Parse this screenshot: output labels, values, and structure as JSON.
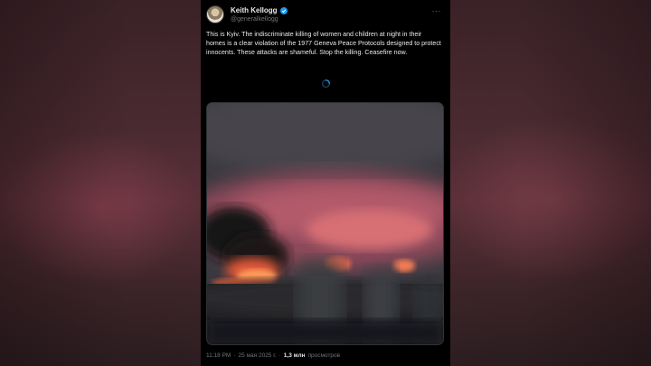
{
  "author": {
    "name": "Keith Kellogg",
    "handle": "@generalkellogg",
    "verified": true
  },
  "tweet": {
    "text": "This is Kyiv. The indiscriminate killing of women and children at night in their homes is a clear violation of the 1977 Geneva Peace Protocols designed to protect innocents. These attacks are shameful. Stop the killing. Ceasefire now."
  },
  "media": {
    "type": "video",
    "description_icon": "loading-spinner-icon"
  },
  "footer": {
    "time": "11:18 PM",
    "separator1": "·",
    "date": "25 мая 2025 г.",
    "separator2": "·",
    "views_count": "1,3 млн",
    "views_label": "просмотров"
  },
  "colors": {
    "accent": "#1d9bf0",
    "background": "#000000",
    "text": "#e7e9ea",
    "muted": "#71767b"
  }
}
